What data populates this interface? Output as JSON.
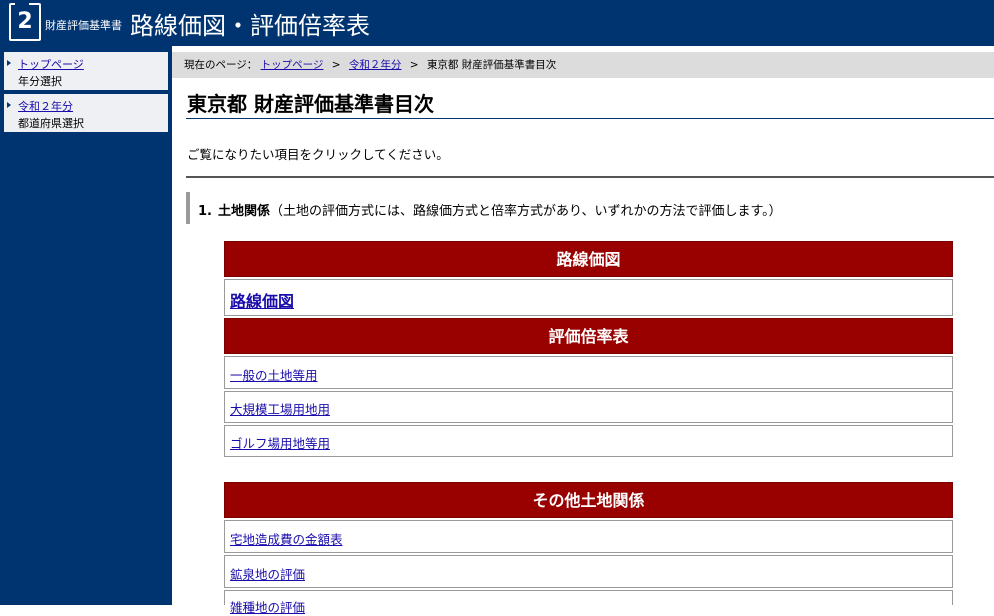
{
  "header": {
    "logo_number": "2",
    "subtitle": "財産評価基準書",
    "title": "路線価図・評価倍率表"
  },
  "sidebar": {
    "items": [
      {
        "label": "トップページ",
        "sub": "年分選択"
      },
      {
        "label": "令和２年分",
        "sub": "都道府県選択"
      }
    ]
  },
  "breadcrumb": {
    "prefix": "現在のページ：",
    "links": [
      "トップページ",
      "令和２年分"
    ],
    "separator": ">",
    "current": "東京都 財産評価基準書目次"
  },
  "main": {
    "title": "東京都 財産評価基準書目次",
    "intro": "ご覧になりたい項目をクリックしてください。",
    "section": {
      "number": "1.",
      "name": "土地関係",
      "note": "（土地の評価方式には、路線価方式と倍率方式があり、いずれかの方法で評価します。）"
    },
    "tables": [
      {
        "heading": "路線価図",
        "links": [
          "路線価図"
        ]
      },
      {
        "heading": "評価倍率表",
        "links": [
          "一般の土地等用",
          "大規模工場用地用",
          "ゴルフ場用地等用"
        ]
      },
      {
        "heading": "その他土地関係",
        "links": [
          "宅地造成費の金額表",
          "鉱泉地の評価",
          "雑種地の評価"
        ]
      }
    ]
  },
  "colors": {
    "header_bg": "#003471",
    "table_heading_bg": "#990000",
    "link": "#1a0dab"
  }
}
